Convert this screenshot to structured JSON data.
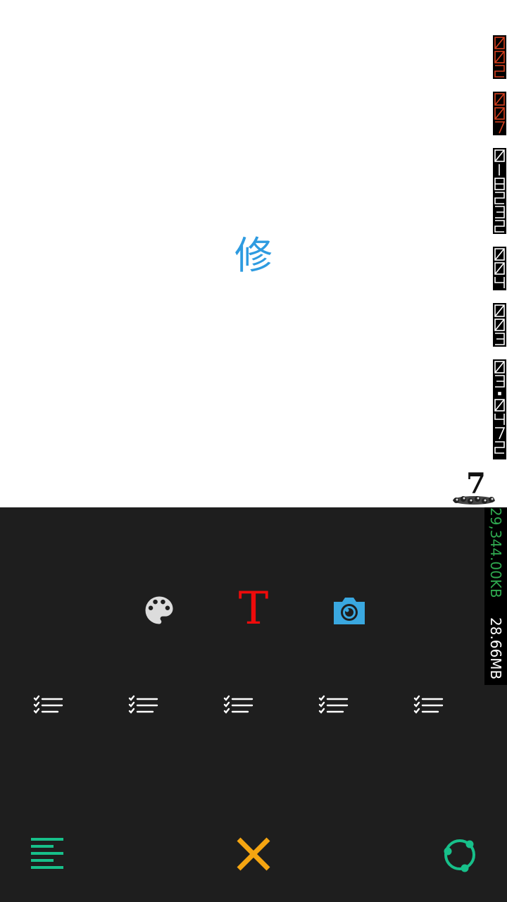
{
  "canvas": {
    "center_glyph": "修"
  },
  "overlay": {
    "memory_kb": "29,344.00KB",
    "memory_mb": "28.66MB",
    "logo_digit": "7"
  },
  "toolbar": {
    "tools": [
      {
        "name": "palette-icon",
        "color": "#dcdcdc"
      },
      {
        "name": "text-tool",
        "label": "T",
        "color": "#ee0b0b"
      },
      {
        "name": "camera-icon",
        "color": "#3aa8e0"
      }
    ],
    "list_items": 5
  },
  "bottom_bar": {
    "left": {
      "icon": "align-left-icon",
      "color": "#17c08a"
    },
    "center": {
      "icon": "close-icon",
      "color": "#f5a511"
    },
    "right": {
      "icon": "refresh-circle-icon",
      "color": "#17c08a"
    }
  },
  "colors": {
    "panel_bg": "#1e1e1e",
    "glyph": "#2e9be0"
  }
}
